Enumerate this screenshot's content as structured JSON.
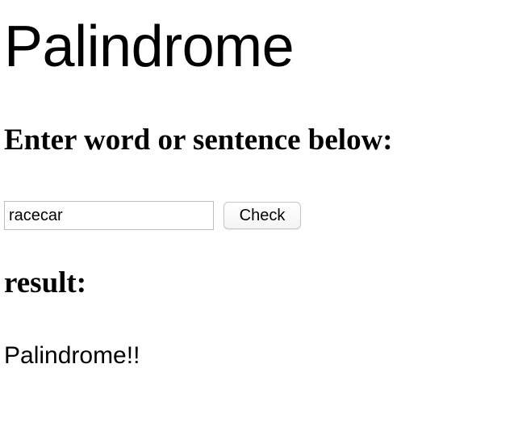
{
  "header": {
    "title": "Palindrome",
    "subtitle": "Enter word or sentence below:"
  },
  "form": {
    "input_value": "racecar",
    "check_label": "Check"
  },
  "result": {
    "label": "result:",
    "value": "Palindrome!!"
  }
}
